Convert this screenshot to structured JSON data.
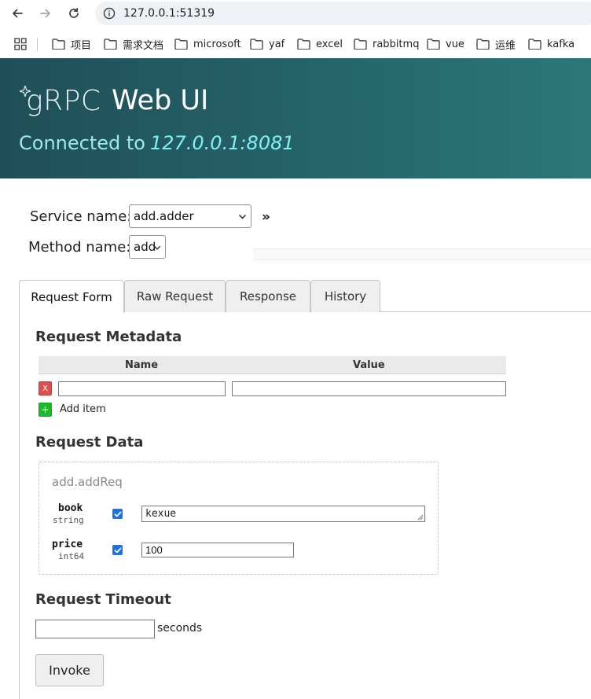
{
  "browser": {
    "url": "127.0.0.1:51319",
    "bookmarks": [
      {
        "label": "项目"
      },
      {
        "label": "需求文档"
      },
      {
        "label": "microsoft"
      },
      {
        "label": "yaf"
      },
      {
        "label": "excel"
      },
      {
        "label": "rabbitmq"
      },
      {
        "label": "vue"
      },
      {
        "label": "运维"
      },
      {
        "label": "kafka"
      }
    ]
  },
  "header": {
    "logo_text": "gRPC",
    "title": "Web UI",
    "connected_label": "Connected to",
    "host": "127.0.0.1:8081",
    "gradient_start": "#1f4e58",
    "gradient_end": "#2b7777"
  },
  "selectors": {
    "service_label": "Service name:",
    "service_value": "add.adder",
    "method_label": "Method name:",
    "method_value": "add",
    "expand_symbol": "»"
  },
  "tabs": [
    {
      "label": "Request Form",
      "active": true
    },
    {
      "label": "Raw Request",
      "active": false
    },
    {
      "label": "Response",
      "active": false
    },
    {
      "label": "History",
      "active": false
    }
  ],
  "metadata": {
    "heading": "Request Metadata",
    "col_name": "Name",
    "col_value": "Value",
    "remove_symbol": "X",
    "add_symbol": "+",
    "add_label": "Add item",
    "row_name": "",
    "row_value": ""
  },
  "request_data": {
    "heading": "Request Data",
    "message": "add.addReq",
    "fields": [
      {
        "name": "book",
        "type": "string",
        "checked": true,
        "value": "kexue"
      },
      {
        "name": "price",
        "type": "int64",
        "checked": true,
        "value": "100"
      }
    ]
  },
  "timeout": {
    "heading": "Request Timeout",
    "value": "",
    "unit": "seconds"
  },
  "invoke_label": "Invoke"
}
